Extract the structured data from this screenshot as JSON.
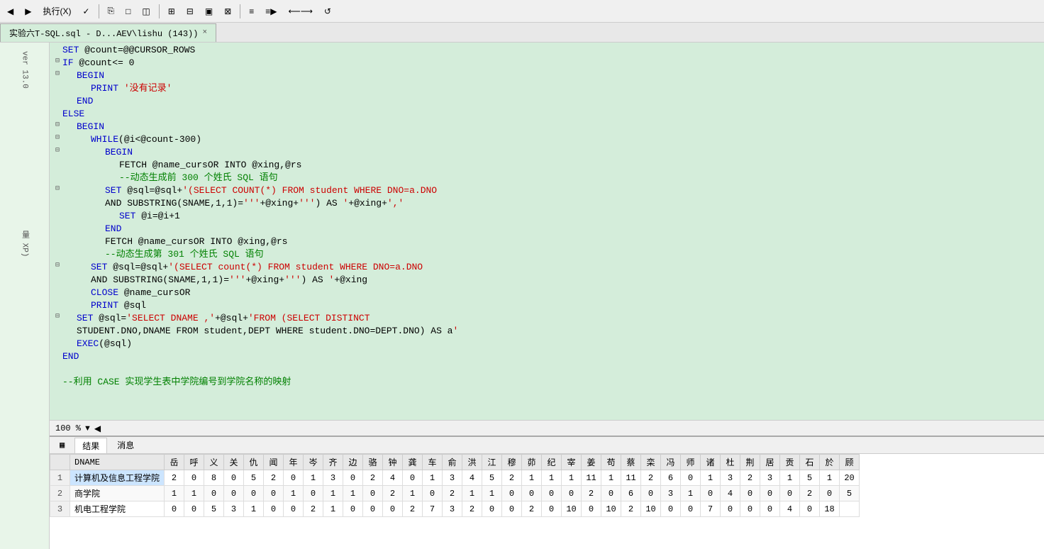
{
  "toolbar": {
    "buttons": [
      "▶",
      "执行(X)",
      "✓",
      "⎘",
      "□",
      "◫",
      "⊞",
      "⊟",
      "▣",
      "⊠",
      "≡",
      "≡▶",
      "⟵⟶",
      "↺"
    ]
  },
  "tab": {
    "label": "实验六T-SQL.sql - D...AEV\\lishu (143))",
    "close": "×"
  },
  "sidebar": {
    "labels": [
      "ver 13.0",
      "量 XP)"
    ]
  },
  "editor": {
    "lines": [
      {
        "indent": 0,
        "fold": "",
        "content": "SET @count=@@CURSOR_ROWS",
        "color": "plain"
      },
      {
        "indent": 1,
        "fold": "⊟",
        "content": "IF @count<= 0",
        "color": "kw"
      },
      {
        "indent": 2,
        "fold": "⊟",
        "content": "BEGIN",
        "color": "kw"
      },
      {
        "indent": 3,
        "fold": "",
        "content": "PRINT '没有记录'",
        "color": "plain"
      },
      {
        "indent": 2,
        "fold": "",
        "content": "END",
        "color": "kw"
      },
      {
        "indent": 1,
        "fold": "",
        "content": "ELSE",
        "color": "kw"
      },
      {
        "indent": 2,
        "fold": "⊟",
        "content": "BEGIN",
        "color": "kw"
      },
      {
        "indent": 3,
        "fold": "⊟",
        "content": "WHILE @i<@count-300",
        "color": "kw"
      },
      {
        "indent": 4,
        "fold": "⊟",
        "content": "BEGIN",
        "color": "kw"
      },
      {
        "indent": 5,
        "fold": "",
        "content": "FETCH @name_cursOR INTO @xing,@rs",
        "color": "plain"
      },
      {
        "indent": 5,
        "fold": "",
        "content": "--动态生成前 300 个姓氏 SQL 语句",
        "color": "comment"
      },
      {
        "indent": 4,
        "fold": "⊟",
        "content": "SET @sql=@sql+'(SELECT COUNT(*) FROM student WHERE DNO=a.DNO",
        "color": "plain"
      },
      {
        "indent": 4,
        "fold": "",
        "content": "AND SUBSTRING(SNAME,1,1)='''+@xing+''') AS '+@xing+','",
        "color": "plain"
      },
      {
        "indent": 5,
        "fold": "",
        "content": "SET @i=@i+1",
        "color": "plain"
      },
      {
        "indent": 4,
        "fold": "",
        "content": "END",
        "color": "kw"
      },
      {
        "indent": 4,
        "fold": "",
        "content": "FETCH @name_cursOR INTO @xing,@rs",
        "color": "plain"
      },
      {
        "indent": 4,
        "fold": "",
        "content": "--动态生成第 301 个姓氏 SQL 语句",
        "color": "comment"
      },
      {
        "indent": 3,
        "fold": "⊟",
        "content": "SET @sql=@sql+'(SELECT count(*) FROM student WHERE DNO=a.DNO",
        "color": "plain"
      },
      {
        "indent": 3,
        "fold": "",
        "content": "AND SUBSTRING(SNAME,1,1)='''+@xing+''') AS '+@xing",
        "color": "plain"
      },
      {
        "indent": 3,
        "fold": "",
        "content": "CLOSE @name_cursOR",
        "color": "plain"
      },
      {
        "indent": 3,
        "fold": "",
        "content": "PRINT @sql",
        "color": "plain"
      },
      {
        "indent": 2,
        "fold": "⊟",
        "content": "SET @sql='SELECT DNAME ,'+@sql+'FROM (SELECT DISTINCT",
        "color": "plain"
      },
      {
        "indent": 2,
        "fold": "",
        "content": "STUDENT.DNO,DNAME FROM student,DEPT WHERE student.DNO=DEPT.DNO) AS a'",
        "color": "plain"
      },
      {
        "indent": 2,
        "fold": "",
        "content": "EXEC(@sql)",
        "color": "plain"
      },
      {
        "indent": 1,
        "fold": "",
        "content": "END",
        "color": "kw"
      },
      {
        "indent": 0,
        "fold": "",
        "content": "",
        "color": "plain"
      },
      {
        "indent": 0,
        "fold": "",
        "content": "--利用 CASE 实现学生表中学院编号到学院名称的映射",
        "color": "comment"
      }
    ]
  },
  "zoom": {
    "level": "100 %"
  },
  "results": {
    "tabs": [
      "结果",
      "消息"
    ],
    "active_tab": "结果",
    "headers": [
      "DNAME",
      "岳",
      "呼",
      "义",
      "关",
      "仇",
      "闻",
      "年",
      "岑",
      "齐",
      "边",
      "骆",
      "钟",
      "龚",
      "车",
      "俞",
      "洪",
      "江",
      "穆",
      "茆",
      "纪",
      "宰",
      "姜",
      "苟",
      "蔡",
      "栾",
      "冯",
      "师",
      "诸",
      "杜",
      "荆",
      "居",
      "贡",
      "石",
      "於",
      "顾"
    ],
    "rows": [
      {
        "num": "1",
        "dname": "计算机及信息工程学院",
        "values": [
          "2",
          "0",
          "8",
          "0",
          "5",
          "2",
          "0",
          "1",
          "3",
          "0",
          "2",
          "4",
          "0",
          "1",
          "3",
          "4",
          "5",
          "2",
          "1",
          "1",
          "1",
          "11",
          "1",
          "11",
          "2",
          "6",
          "0",
          "1",
          "3",
          "2",
          "3",
          "1",
          "5",
          "1",
          "20"
        ]
      },
      {
        "num": "2",
        "dname": "商学院",
        "values": [
          "1",
          "1",
          "0",
          "0",
          "0",
          "0",
          "1",
          "0",
          "1",
          "1",
          "0",
          "2",
          "1",
          "0",
          "2",
          "1",
          "1",
          "0",
          "0",
          "0",
          "0",
          "2",
          "0",
          "6",
          "0",
          "3",
          "1",
          "0",
          "4",
          "0",
          "0",
          "0",
          "2",
          "0",
          "5"
        ]
      },
      {
        "num": "3",
        "dname": "机电工程学院",
        "values": [
          "0",
          "0",
          "5",
          "3",
          "1",
          "0",
          "0",
          "2",
          "1",
          "0",
          "0",
          "0",
          "2",
          "7",
          "3",
          "2",
          "0",
          "0",
          "2",
          "0",
          "10",
          "0",
          "10",
          "2",
          "10",
          "0",
          "0",
          "7",
          "0",
          "0",
          "0",
          "4",
          "0",
          "18",
          ""
        ]
      }
    ]
  }
}
